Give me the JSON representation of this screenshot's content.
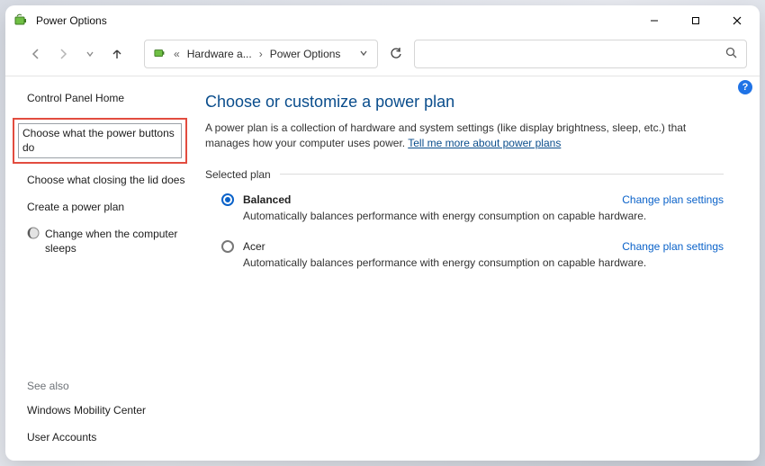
{
  "window": {
    "title": "Power Options"
  },
  "breadcrumb": {
    "prefix": "«",
    "item1": "Hardware a...",
    "item2": "Power Options"
  },
  "help_badge": "?",
  "sidebar": {
    "home": "Control Panel Home",
    "link_power_buttons": "Choose what the power buttons do",
    "link_closing_lid": "Choose what closing the lid does",
    "link_create_plan": "Create a power plan",
    "link_change_sleep": "Change when the computer sleeps",
    "see_also_label": "See also",
    "see_also_1": "Windows Mobility Center",
    "see_also_2": "User Accounts"
  },
  "main": {
    "heading": "Choose or customize a power plan",
    "description_pre": "A power plan is a collection of hardware and system settings (like display brightness, sleep, etc.) that manages how your computer uses power. ",
    "description_link": "Tell me more about power plans",
    "selected_plan_label": "Selected plan",
    "plans": [
      {
        "name": "Balanced",
        "selected": true,
        "change_label": "Change plan settings",
        "desc": "Automatically balances performance with energy consumption on capable hardware."
      },
      {
        "name": "Acer",
        "selected": false,
        "change_label": "Change plan settings",
        "desc": "Automatically balances performance with energy consumption on capable hardware."
      }
    ]
  }
}
